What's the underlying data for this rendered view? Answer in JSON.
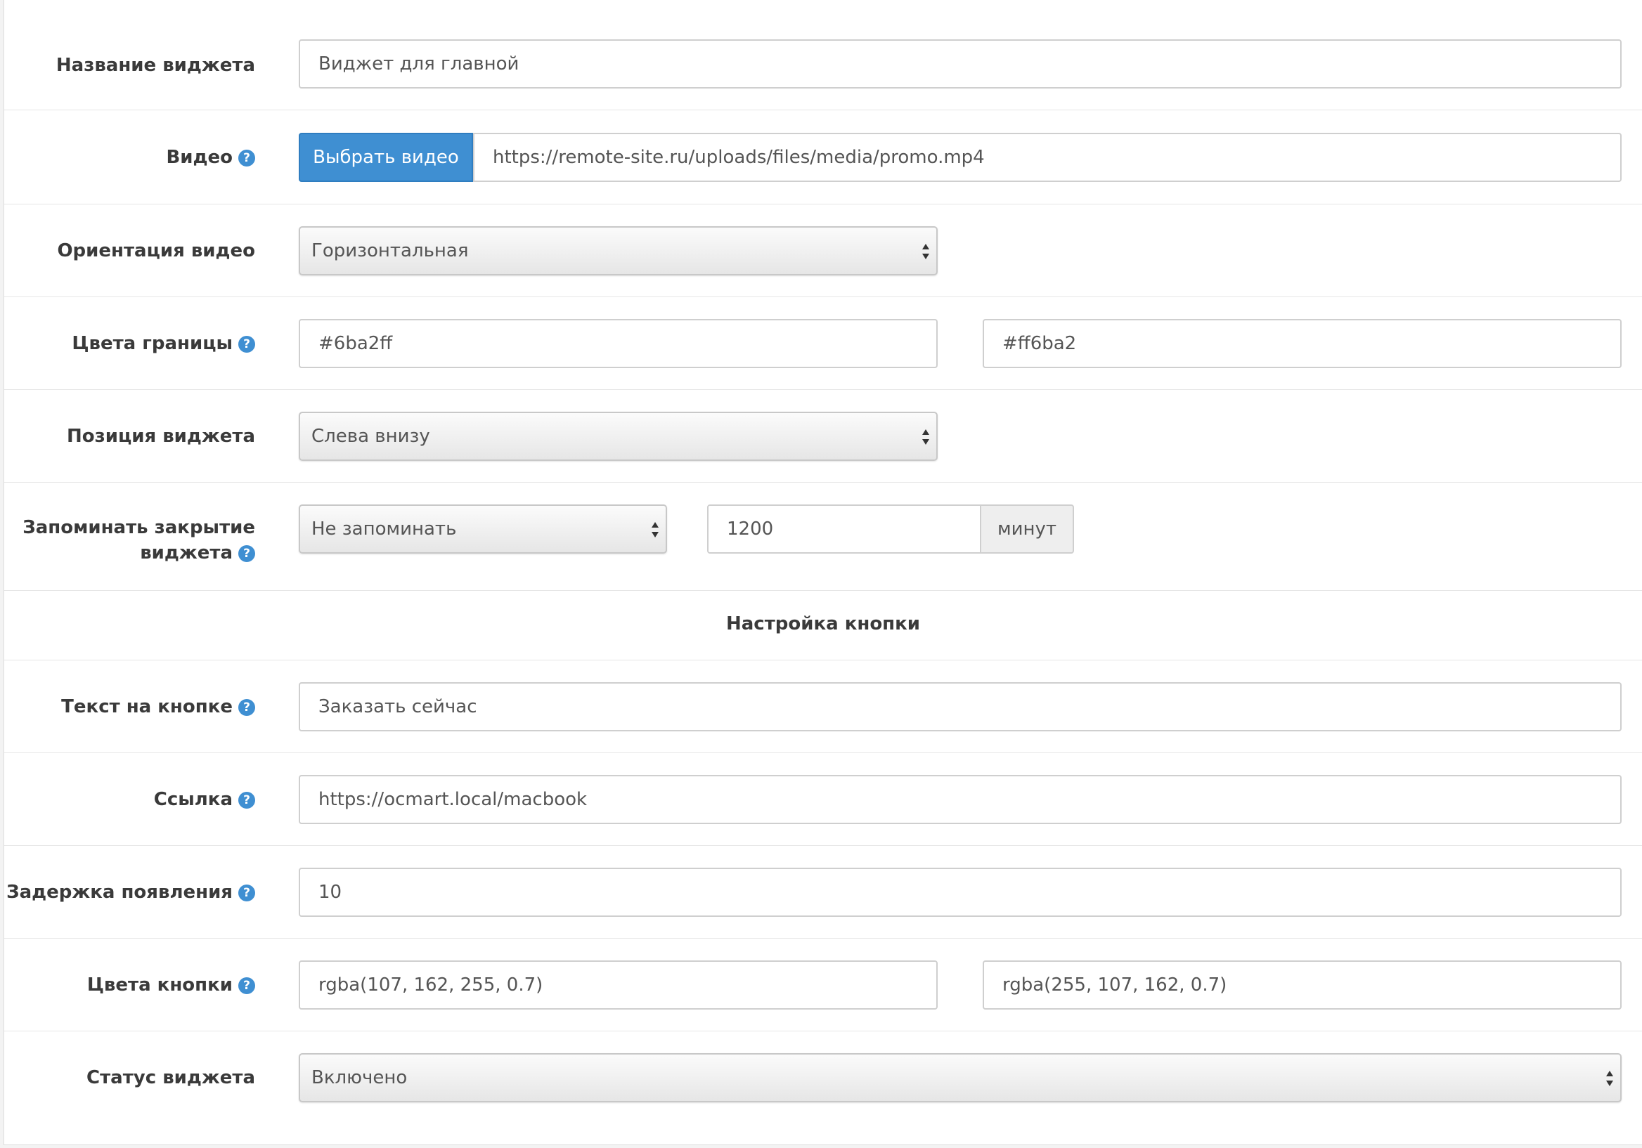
{
  "form": {
    "widget_name": {
      "label": "Название виджета",
      "value": "Виджет для главной"
    },
    "video": {
      "label": "Видео",
      "button_label": "Выбрать видео",
      "value": "https://remote-site.ru/uploads/files/media/promo.mp4"
    },
    "video_orientation": {
      "label": "Ориентация видео",
      "value": "Горизонтальная"
    },
    "border_colors": {
      "label": "Цвета границы",
      "value_1": "#6ba2ff",
      "value_2": "#ff6ba2"
    },
    "widget_position": {
      "label": "Позиция виджета",
      "value": "Слева внизу"
    },
    "remember_close": {
      "label_line1": "Запоминать закрытие",
      "label_line2": "виджета",
      "select_value": "Не запоминать",
      "minutes_value": "1200",
      "unit_label": "минут"
    },
    "section_button": {
      "title": "Настройка кнопки"
    },
    "button_text": {
      "label": "Текст на кнопке",
      "value": "Заказать сейчас"
    },
    "link": {
      "label": "Ссылка",
      "value": "https://ocmart.local/macbook"
    },
    "delay": {
      "label": "Задержка появления",
      "value": "10"
    },
    "button_colors": {
      "label": "Цвета кнопки",
      "value_1": "rgba(107, 162, 255, 0.7)",
      "value_2": "rgba(255, 107, 162, 0.7)"
    },
    "status": {
      "label": "Статус виджета",
      "value": "Включено"
    }
  },
  "icons": {
    "help": "question-circle-icon",
    "select_arrows": "up-down-arrows-icon"
  },
  "colors": {
    "accent": "#3f8fd2",
    "border": "#cfcfcf"
  }
}
